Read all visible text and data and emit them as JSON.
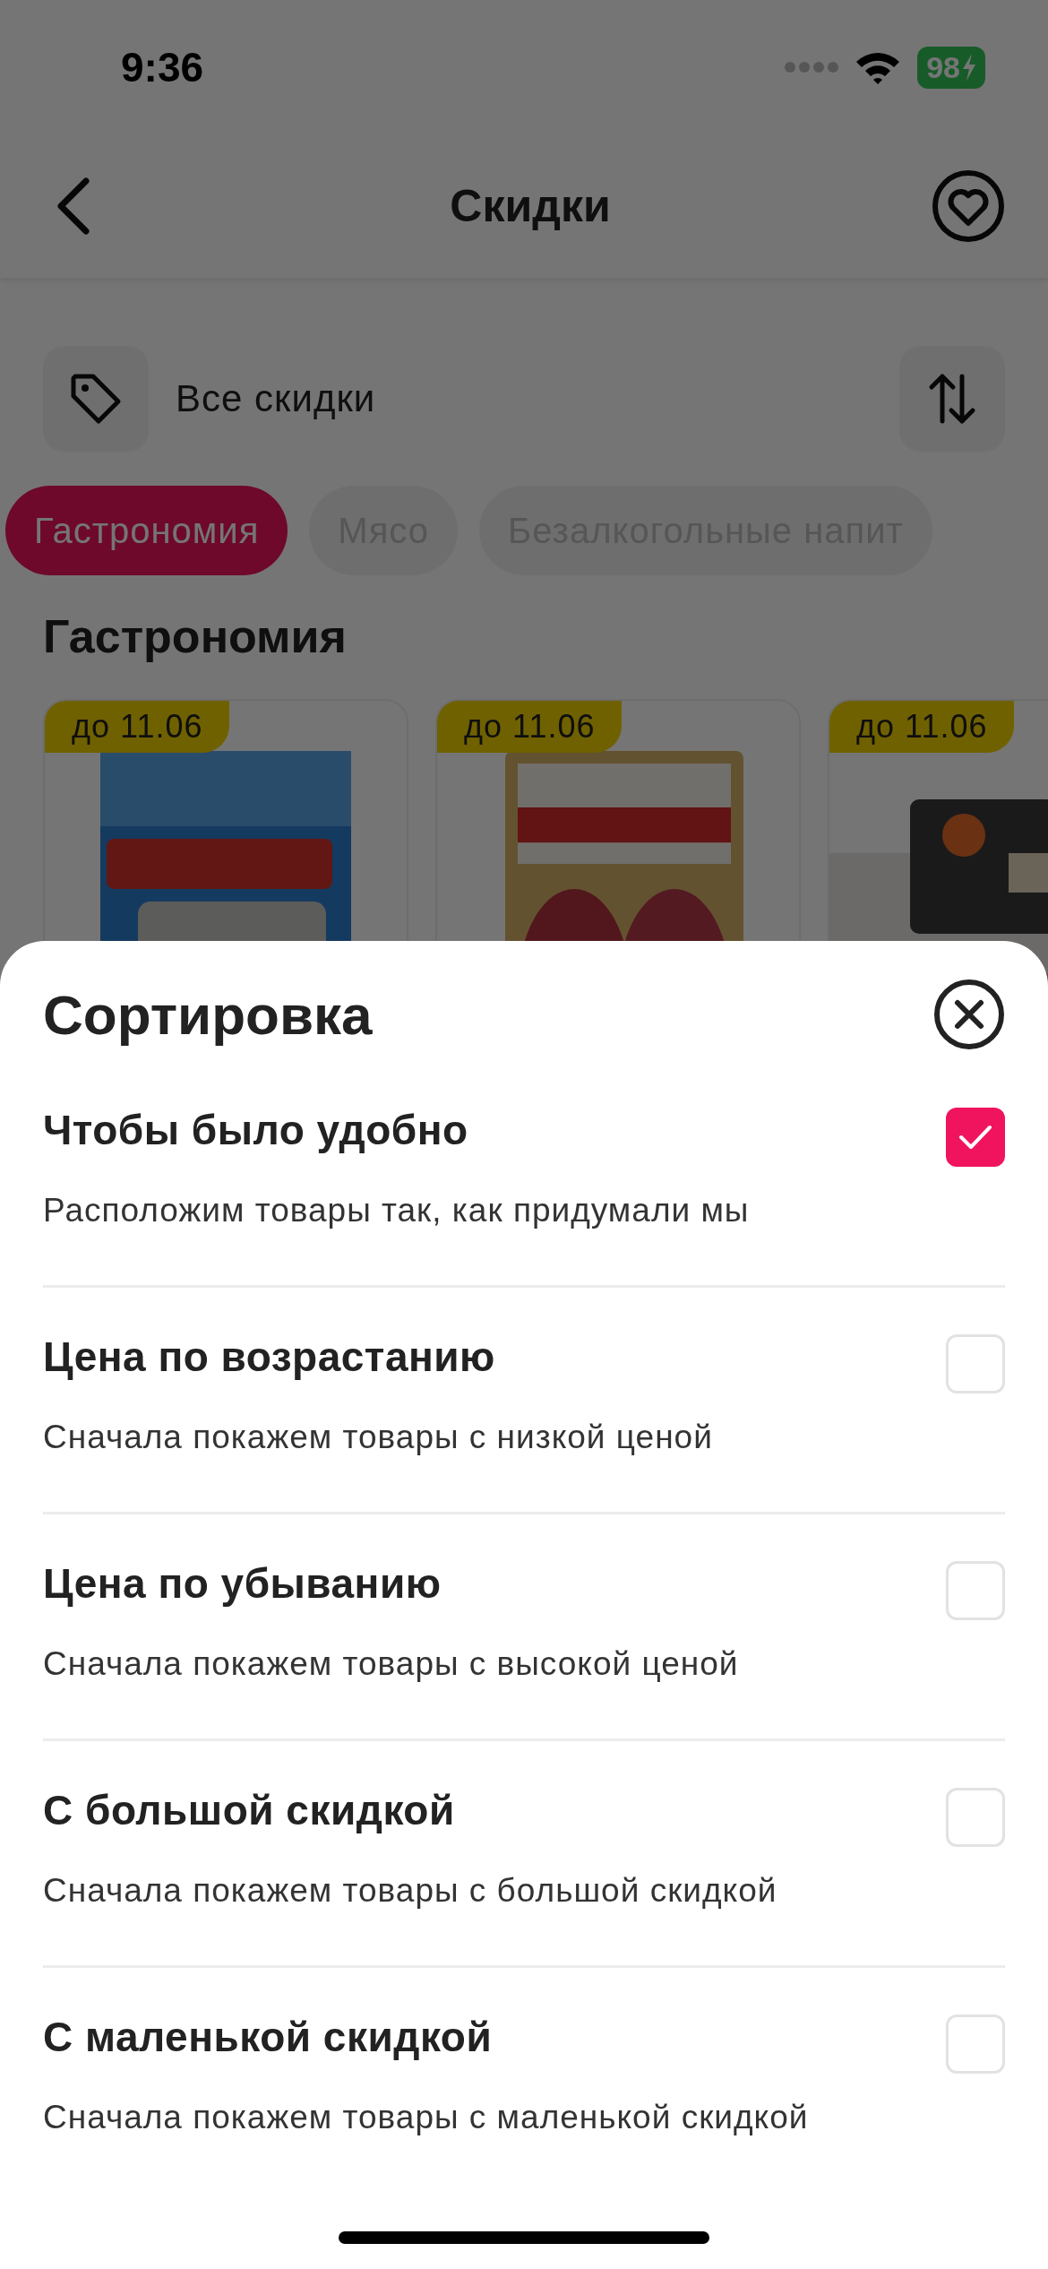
{
  "status_bar": {
    "time": "9:36",
    "battery": "98"
  },
  "nav": {
    "title": "Скидки"
  },
  "filter": {
    "label": "Все скидки"
  },
  "categories": [
    {
      "label": "Гастрономия",
      "selected": true
    },
    {
      "label": "Мясо",
      "selected": false
    },
    {
      "label": "Безалкогольные напит",
      "selected": false
    }
  ],
  "section_title": "Гастрономия",
  "products": [
    {
      "badge": "до 11.06",
      "kind": "picture"
    },
    {
      "badge": "до 11.06",
      "kind": "picture"
    },
    {
      "badge": "до 11.06",
      "kind": "picture"
    }
  ],
  "sort_sheet": {
    "title": "Сортировка",
    "options": [
      {
        "title": "Чтобы было удобно",
        "description": "Расположим товары так, как придумали мы",
        "checked": true
      },
      {
        "title": "Цена по возрастанию",
        "description": "Сначала покажем товары с низкой ценой",
        "checked": false
      },
      {
        "title": "Цена по убыванию",
        "description": "Сначала покажем товары с высокой ценой",
        "checked": false
      },
      {
        "title": "С большой скидкой",
        "description": "Сначала покажем товары с большой скидкой",
        "checked": false
      },
      {
        "title": "С маленькой скидкой",
        "description": "Сначала покажем товары с маленькой скидкой",
        "checked": false
      }
    ]
  }
}
